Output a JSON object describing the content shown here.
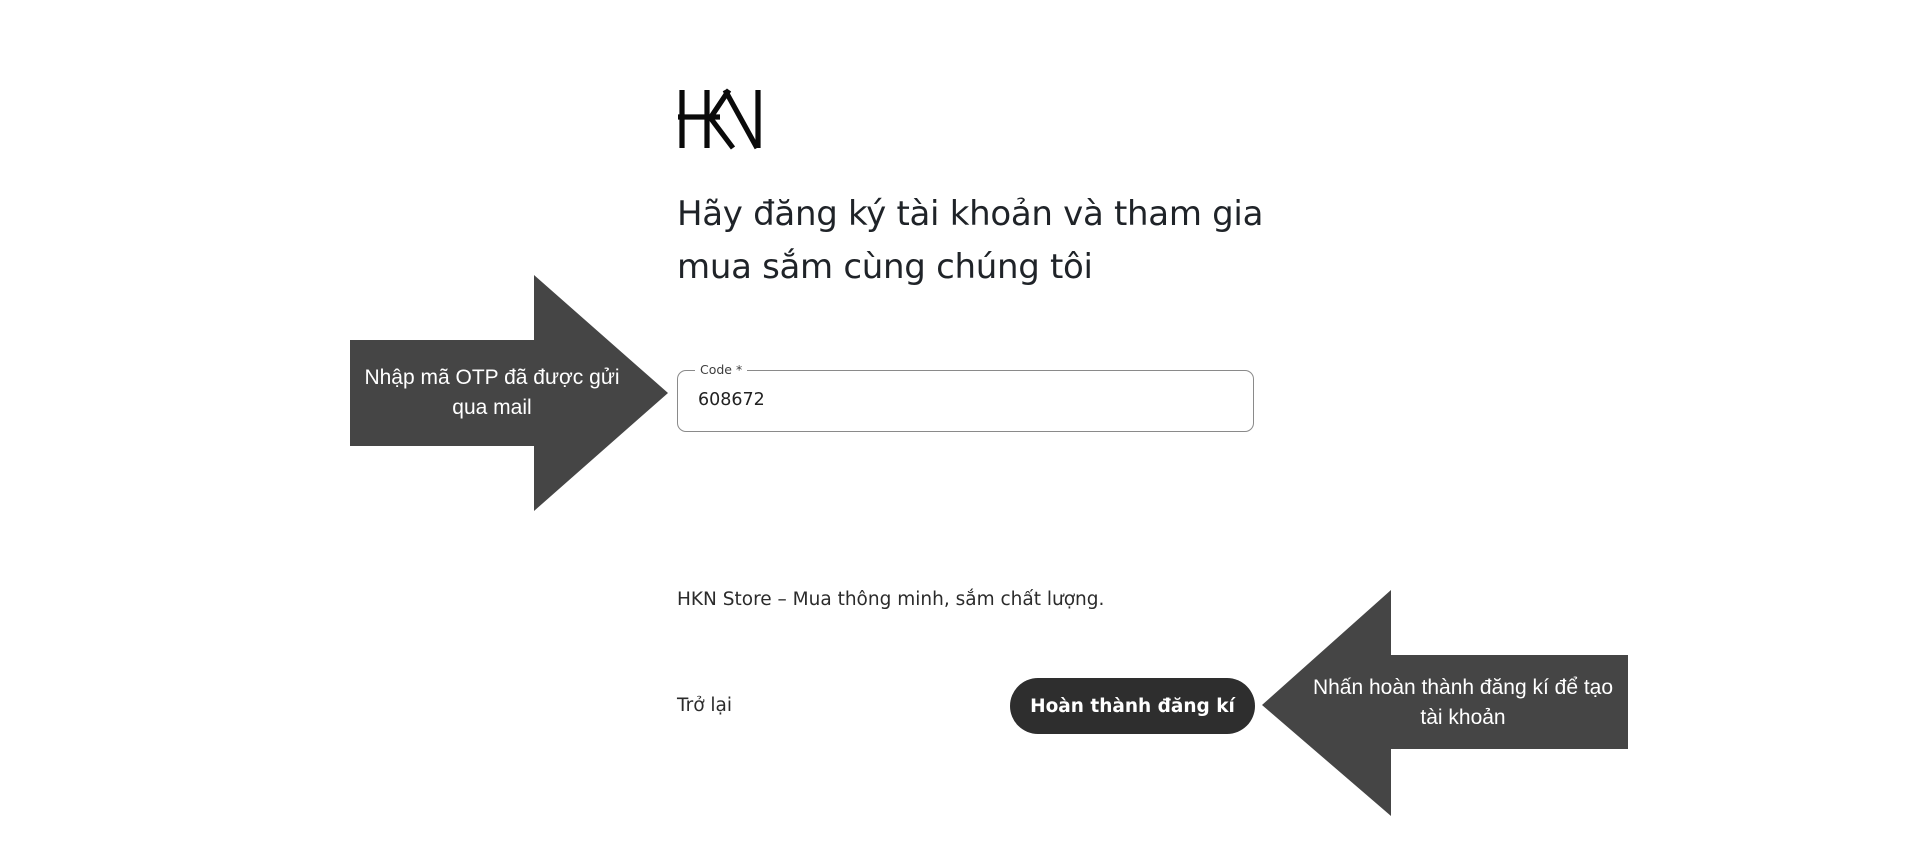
{
  "brand": {
    "logo_text": "HKN"
  },
  "heading": {
    "line1": "Hãy đăng ký tài khoản và tham gia",
    "line2": "mua sắm cùng chúng tôi"
  },
  "code_field": {
    "label": "Code *",
    "value": "608672"
  },
  "tagline": "HKN Store – Mua thông minh, sắm chất lượng.",
  "actions": {
    "back_label": "Trở lại",
    "submit_label": "Hoàn thành đăng kí"
  },
  "annotations": {
    "otp_hint": "Nhập mã OTP đã được gửi qua mail",
    "submit_hint": "Nhấn hoàn thành đăng kí để tạo tài khoản"
  },
  "colors": {
    "button_bg": "#2e2e2e",
    "callout_bg": "#454545",
    "field_border": "#8a8a8a"
  }
}
